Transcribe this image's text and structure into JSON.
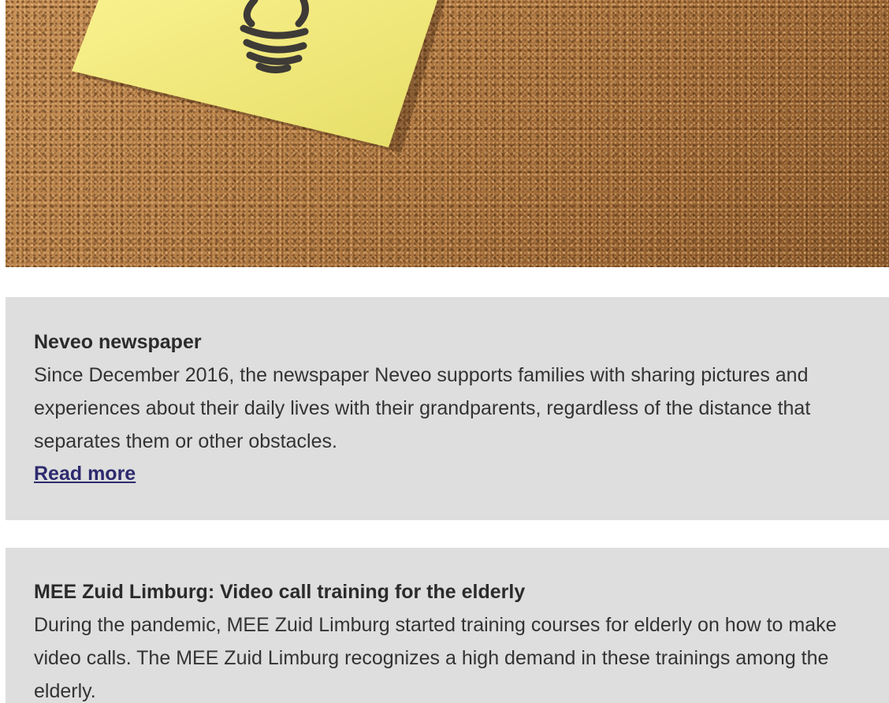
{
  "hero": {
    "image": "cork-board-with-lightbulb-sticky-note",
    "colors": {
      "cork": "#b9834a",
      "note": "#f3ec7a",
      "bulb": "#3e3a36"
    }
  },
  "cards": [
    {
      "title": "Neveo newspaper",
      "text": "Since December 2016, the newspaper Neveo supports families with sharing pictures and experiences about their daily lives with their grandparents, regardless of the distance that separates them or other obstacles.",
      "link": "Read more"
    },
    {
      "title": "MEE Zuid Limburg: Video call training for the elderly",
      "text": "During the pandemic, MEE Zuid Limburg started training courses for elderly on how to make video calls. The MEE Zuid Limburg recognizes a high demand in these trainings among the elderly."
    }
  ],
  "colors": {
    "card_background": "#dedede",
    "link": "#2d2a6e",
    "text": "#333333"
  }
}
